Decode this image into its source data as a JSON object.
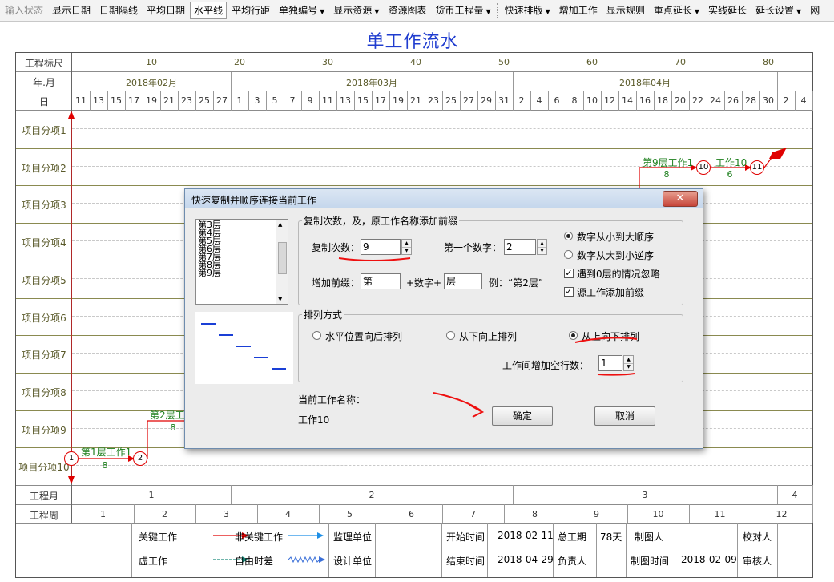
{
  "toolbar": {
    "items": [
      "输入状态",
      "显示日期",
      "日期隔线",
      "平均日期",
      "水平线",
      "平均行距",
      "单独编号",
      "显示资源",
      "资源图表",
      "货币工程量",
      "快速排版",
      "增加工作",
      "显示规则",
      "重点延长",
      "实线延长",
      "延长设置",
      "网"
    ]
  },
  "chart": {
    "title": "单工作流水",
    "row_headers": {
      "project_scale": "工程标尺",
      "year_month": "年.月",
      "day": "日"
    },
    "scale_numbers": [
      "10",
      "20",
      "30",
      "40",
      "50",
      "60",
      "70",
      "80"
    ],
    "months": [
      "2018年02月",
      "2018年03月",
      "2018年04月"
    ],
    "days": [
      "11",
      "13",
      "15",
      "17",
      "19",
      "21",
      "23",
      "25",
      "27",
      "1",
      "3",
      "5",
      "7",
      "9",
      "11",
      "13",
      "15",
      "17",
      "19",
      "21",
      "23",
      "25",
      "27",
      "29",
      "31",
      "2",
      "4",
      "6",
      "8",
      "10",
      "12",
      "14",
      "16",
      "18",
      "20",
      "22",
      "24",
      "26",
      "28",
      "30",
      "2",
      "4"
    ],
    "rows": [
      "项目分项1",
      "项目分项2",
      "项目分项3",
      "项目分项4",
      "项目分项5",
      "项目分项6",
      "项目分项7",
      "项目分项8",
      "项目分项9",
      "项目分项10"
    ],
    "footer_month_label": "工程月",
    "footer_week_label": "工程周",
    "project_months": [
      "1",
      "2",
      "3",
      "4"
    ],
    "project_weeks": [
      "1",
      "2",
      "3",
      "4",
      "5",
      "6",
      "7",
      "8",
      "9",
      "10",
      "11",
      "12"
    ],
    "tasks": {
      "t1": {
        "name": "第1层工作1",
        "duration": "8",
        "from": "1",
        "to": "2"
      },
      "t2": {
        "name": "第2层工作1",
        "duration": "8"
      },
      "t9": {
        "name": "第9层工作1",
        "duration": "8",
        "to": "10"
      },
      "t10": {
        "name": "工作10",
        "duration": "6",
        "to": "11"
      }
    },
    "legend": {
      "critical": "关键工作",
      "noncritical": "非关键工作",
      "supervisor": "监理单位",
      "dummy": "虚工作",
      "free_float": "自由时差",
      "designer": "设计单位",
      "start_time_label": "开始时间",
      "start_time": "2018-02-11",
      "end_time_label": "结束时间",
      "end_time": "2018-04-29",
      "total_duration_label": "总工期",
      "total_duration": "78天",
      "owner_label": "负责人",
      "drawer_label": "制图人",
      "draw_time_label": "制图时间",
      "draw_time": "2018-02-09",
      "checker_label": "校对人",
      "reviewer_label": "审核人"
    },
    "colors": {
      "critical": "#e00000",
      "noncritical": "#1e8fe6",
      "dummy": "#1a8a7a",
      "free_float": "#3a6fd8",
      "title": "#1f3ccf"
    }
  },
  "dialog": {
    "title": "快速复制并顺序连接当前工作",
    "list_items": [
      "第3层",
      "第4层",
      "第5层",
      "第6层",
      "第7层",
      "第8层",
      "第9层"
    ],
    "copy_group_label": "复制次数，及，原工作名称添加前缀",
    "copy_count_label": "复制次数：",
    "copy_count": "9",
    "first_number_label": "第一个数字：",
    "first_number": "2",
    "prefix_label": "增加前缀：",
    "prefix": "第",
    "plus_number_label": "+数字+",
    "suffix": "层",
    "example_label": "例：“第2层”",
    "options": {
      "asc": "数字从小到大顺序",
      "desc": "数字从大到小逆序",
      "ignore_zero": "遇到0层的情况忽略",
      "source_prefix": "源工作添加前缀"
    },
    "arrange_group_label": "排列方式",
    "arrange": {
      "horizontal": "水平位置向后排列",
      "bottom_up": "从下向上排列",
      "top_down": "从上向下排列"
    },
    "blank_rows_label": "工作间增加空行数：",
    "blank_rows": "1",
    "current_work_label": "当前工作名称：",
    "current_work": "工作10",
    "ok": "确定",
    "cancel": "取消"
  }
}
